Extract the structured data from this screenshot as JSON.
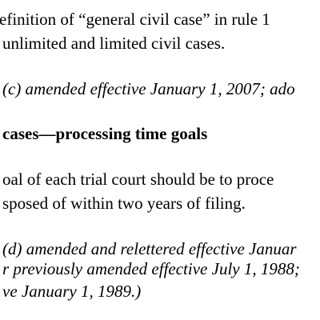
{
  "paragraph_top": {
    "line1": "efinition of “general civil case” in rule 1",
    "line2": "unlimited and limited civil cases."
  },
  "amendment_note_c": "(c) amended effective January 1, 2007; ado",
  "section_heading": "cases—processing time goals",
  "paragraph_goal": {
    "line1": "oal of each trial court should be to proce",
    "line2": "sposed of within two years of filing."
  },
  "amendment_note_d": {
    "line1": "(d) amended and relettered effective Januar",
    "line2": "r previously amended effective July 1, 1988;",
    "line3": "ve January 1, 1989.)"
  }
}
